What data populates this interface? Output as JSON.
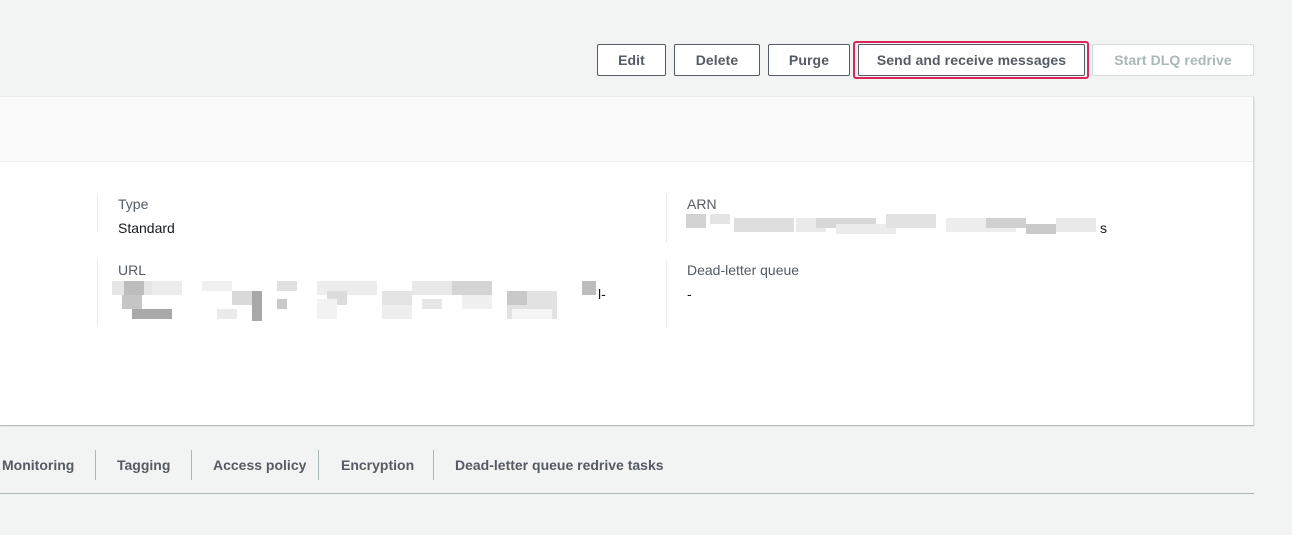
{
  "toolbar": {
    "edit_label": "Edit",
    "delete_label": "Delete",
    "purge_label": "Purge",
    "send_receive_label": "Send and receive messages",
    "start_dlq_label": "Start DLQ redrive"
  },
  "details": {
    "type_label": "Type",
    "type_value": "Standard",
    "url_label": "URL",
    "url_value_suffix": "l-",
    "arn_label": "ARN",
    "arn_value_suffix": "s",
    "dlq_label": "Dead-letter queue",
    "dlq_value": "-"
  },
  "tabs": [
    {
      "label": "Monitoring"
    },
    {
      "label": "Tagging"
    },
    {
      "label": "Access policy"
    },
    {
      "label": "Encryption"
    },
    {
      "label": "Dead-letter queue redrive tasks"
    }
  ],
  "colors": {
    "highlight": "#e0245e",
    "page_bg": "#f2f3f3",
    "button_border": "#545b64",
    "disabled": "#aab7b8"
  }
}
